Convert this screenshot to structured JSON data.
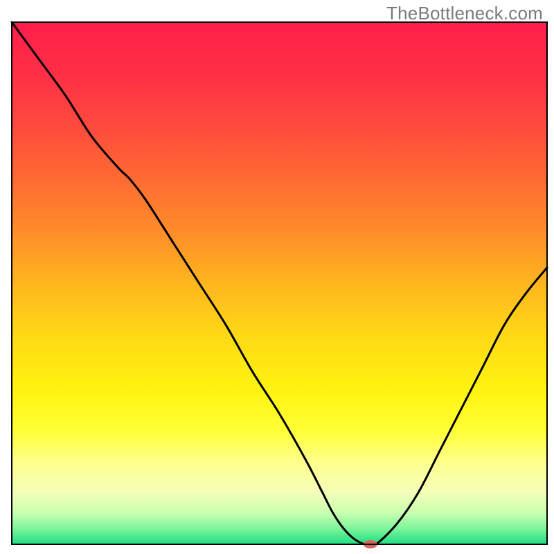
{
  "watermark": "TheBottleneck.com",
  "chart_data": {
    "type": "line",
    "title": "",
    "xlabel": "",
    "ylabel": "",
    "xlim": [
      0,
      100
    ],
    "ylim": [
      0,
      100
    ],
    "grid": false,
    "legend": false,
    "gradient_stops": [
      {
        "offset": 0.0,
        "color": "#ff1e4b"
      },
      {
        "offset": 0.1,
        "color": "#ff2f46"
      },
      {
        "offset": 0.2,
        "color": "#ff4a3e"
      },
      {
        "offset": 0.3,
        "color": "#ff6a33"
      },
      {
        "offset": 0.4,
        "color": "#ff8c2a"
      },
      {
        "offset": 0.5,
        "color": "#ffb51f"
      },
      {
        "offset": 0.6,
        "color": "#ffd916"
      },
      {
        "offset": 0.7,
        "color": "#fff210"
      },
      {
        "offset": 0.78,
        "color": "#ffff33"
      },
      {
        "offset": 0.84,
        "color": "#ffff8a"
      },
      {
        "offset": 0.9,
        "color": "#f4ffb8"
      },
      {
        "offset": 0.94,
        "color": "#c9ffb0"
      },
      {
        "offset": 0.97,
        "color": "#7cf59a"
      },
      {
        "offset": 1.0,
        "color": "#1fdc82"
      }
    ],
    "series": [
      {
        "name": "bottleneck-curve",
        "color": "#000000",
        "x": [
          0,
          5,
          10,
          15,
          20,
          22,
          25,
          30,
          35,
          40,
          45,
          50,
          55,
          58,
          60,
          62,
          64,
          66,
          68,
          72,
          76,
          80,
          84,
          88,
          92,
          96,
          100
        ],
        "y": [
          100,
          93,
          86,
          78,
          72,
          70,
          66,
          58,
          50,
          42,
          33,
          25,
          16,
          10,
          6,
          3,
          1,
          0,
          0,
          4,
          10,
          18,
          26,
          34,
          42,
          48,
          53
        ]
      }
    ],
    "marker": {
      "name": "optimal-marker",
      "x": 67,
      "y": 0,
      "color": "#d9635a",
      "rx": 10,
      "ry": 6
    },
    "plot_frame": {
      "stroke": "#000000",
      "stroke_width": 2
    }
  }
}
